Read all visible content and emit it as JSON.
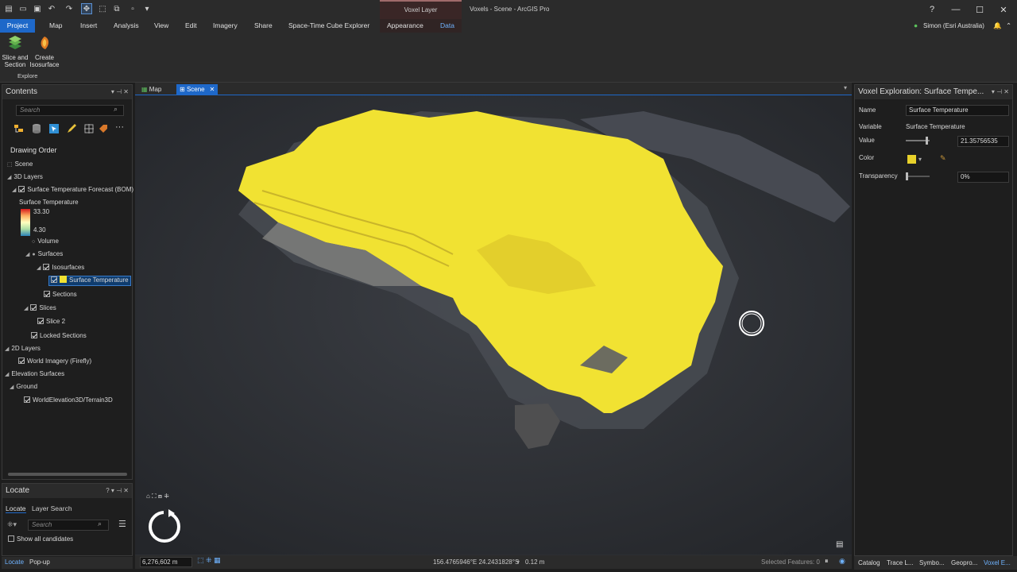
{
  "app": {
    "title": "Voxels - Scene - ArcGIS Pro",
    "contextual_tab_group": "Voxel Layer",
    "user": "Simon (Esri Australia)",
    "help": "?"
  },
  "menu": {
    "items": [
      "Project",
      "Map",
      "Insert",
      "Analysis",
      "View",
      "Edit",
      "Imagery",
      "Share",
      "Space-Time Cube Explorer",
      "Appearance",
      "Data"
    ]
  },
  "ribbon": {
    "slice_label": "Slice and\nSection",
    "iso_label": "Create\nIsosurface",
    "group_label": "Explore"
  },
  "contents": {
    "title": "Contents",
    "search_placeholder": "Search",
    "drawing_order": "Drawing Order",
    "tree": {
      "scene": "Scene",
      "layers3d": "3D Layers",
      "forecast": "Surface Temperature Forecast (BOM)",
      "surface_temp_label": "Surface Temperature",
      "legend_max": "33.30",
      "legend_min": "4.30",
      "volume": "Volume",
      "surfaces": "Surfaces",
      "isosurfaces": "Isosurfaces",
      "surface_temp_item": "Surface Temperature",
      "sections": "Sections",
      "slices": "Slices",
      "slice2": "Slice 2",
      "locked": "Locked Sections",
      "layers2d": "2D Layers",
      "imagery": "World Imagery (Firefly)",
      "elevation": "Elevation Surfaces",
      "ground": "Ground",
      "terrain": "WorldElevation3D/Terrain3D"
    }
  },
  "locate": {
    "title": "Locate",
    "tab_locate": "Locate",
    "tab_layer_search": "Layer Search",
    "search_placeholder": "Search",
    "show_all": "Show all candidates"
  },
  "map_tabs": {
    "map": "Map",
    "scene": "Scene"
  },
  "status": {
    "scale": "6,276,602 m",
    "coords": "156.4765946°E 24.2431828°S",
    "elevation": "0.12 m",
    "selected": "Selected Features: 0",
    "bottom_left_tab1": "Locate",
    "bottom_left_tab2": "Pop-up"
  },
  "voxel_panel": {
    "title": "Voxel Exploration: Surface Tempe...",
    "name_label": "Name",
    "name_value": "Surface Temperature",
    "variable_label": "Variable",
    "variable_value": "Surface Temperature",
    "value_label": "Value",
    "value_value": "21.35756535",
    "color_label": "Color",
    "color_value": "#e8d12a",
    "transparency_label": "Transparency",
    "transparency_value": "0%"
  },
  "bottom_tabs": [
    "Catalog",
    "Trace L...",
    "Symbo...",
    "Geopro...",
    "Voxel E..."
  ],
  "colors": {
    "accent": "#1e68c9",
    "isosurface": "#f1e232",
    "legend_top": "#d7191c",
    "legend_bottom": "#2b83ba"
  }
}
